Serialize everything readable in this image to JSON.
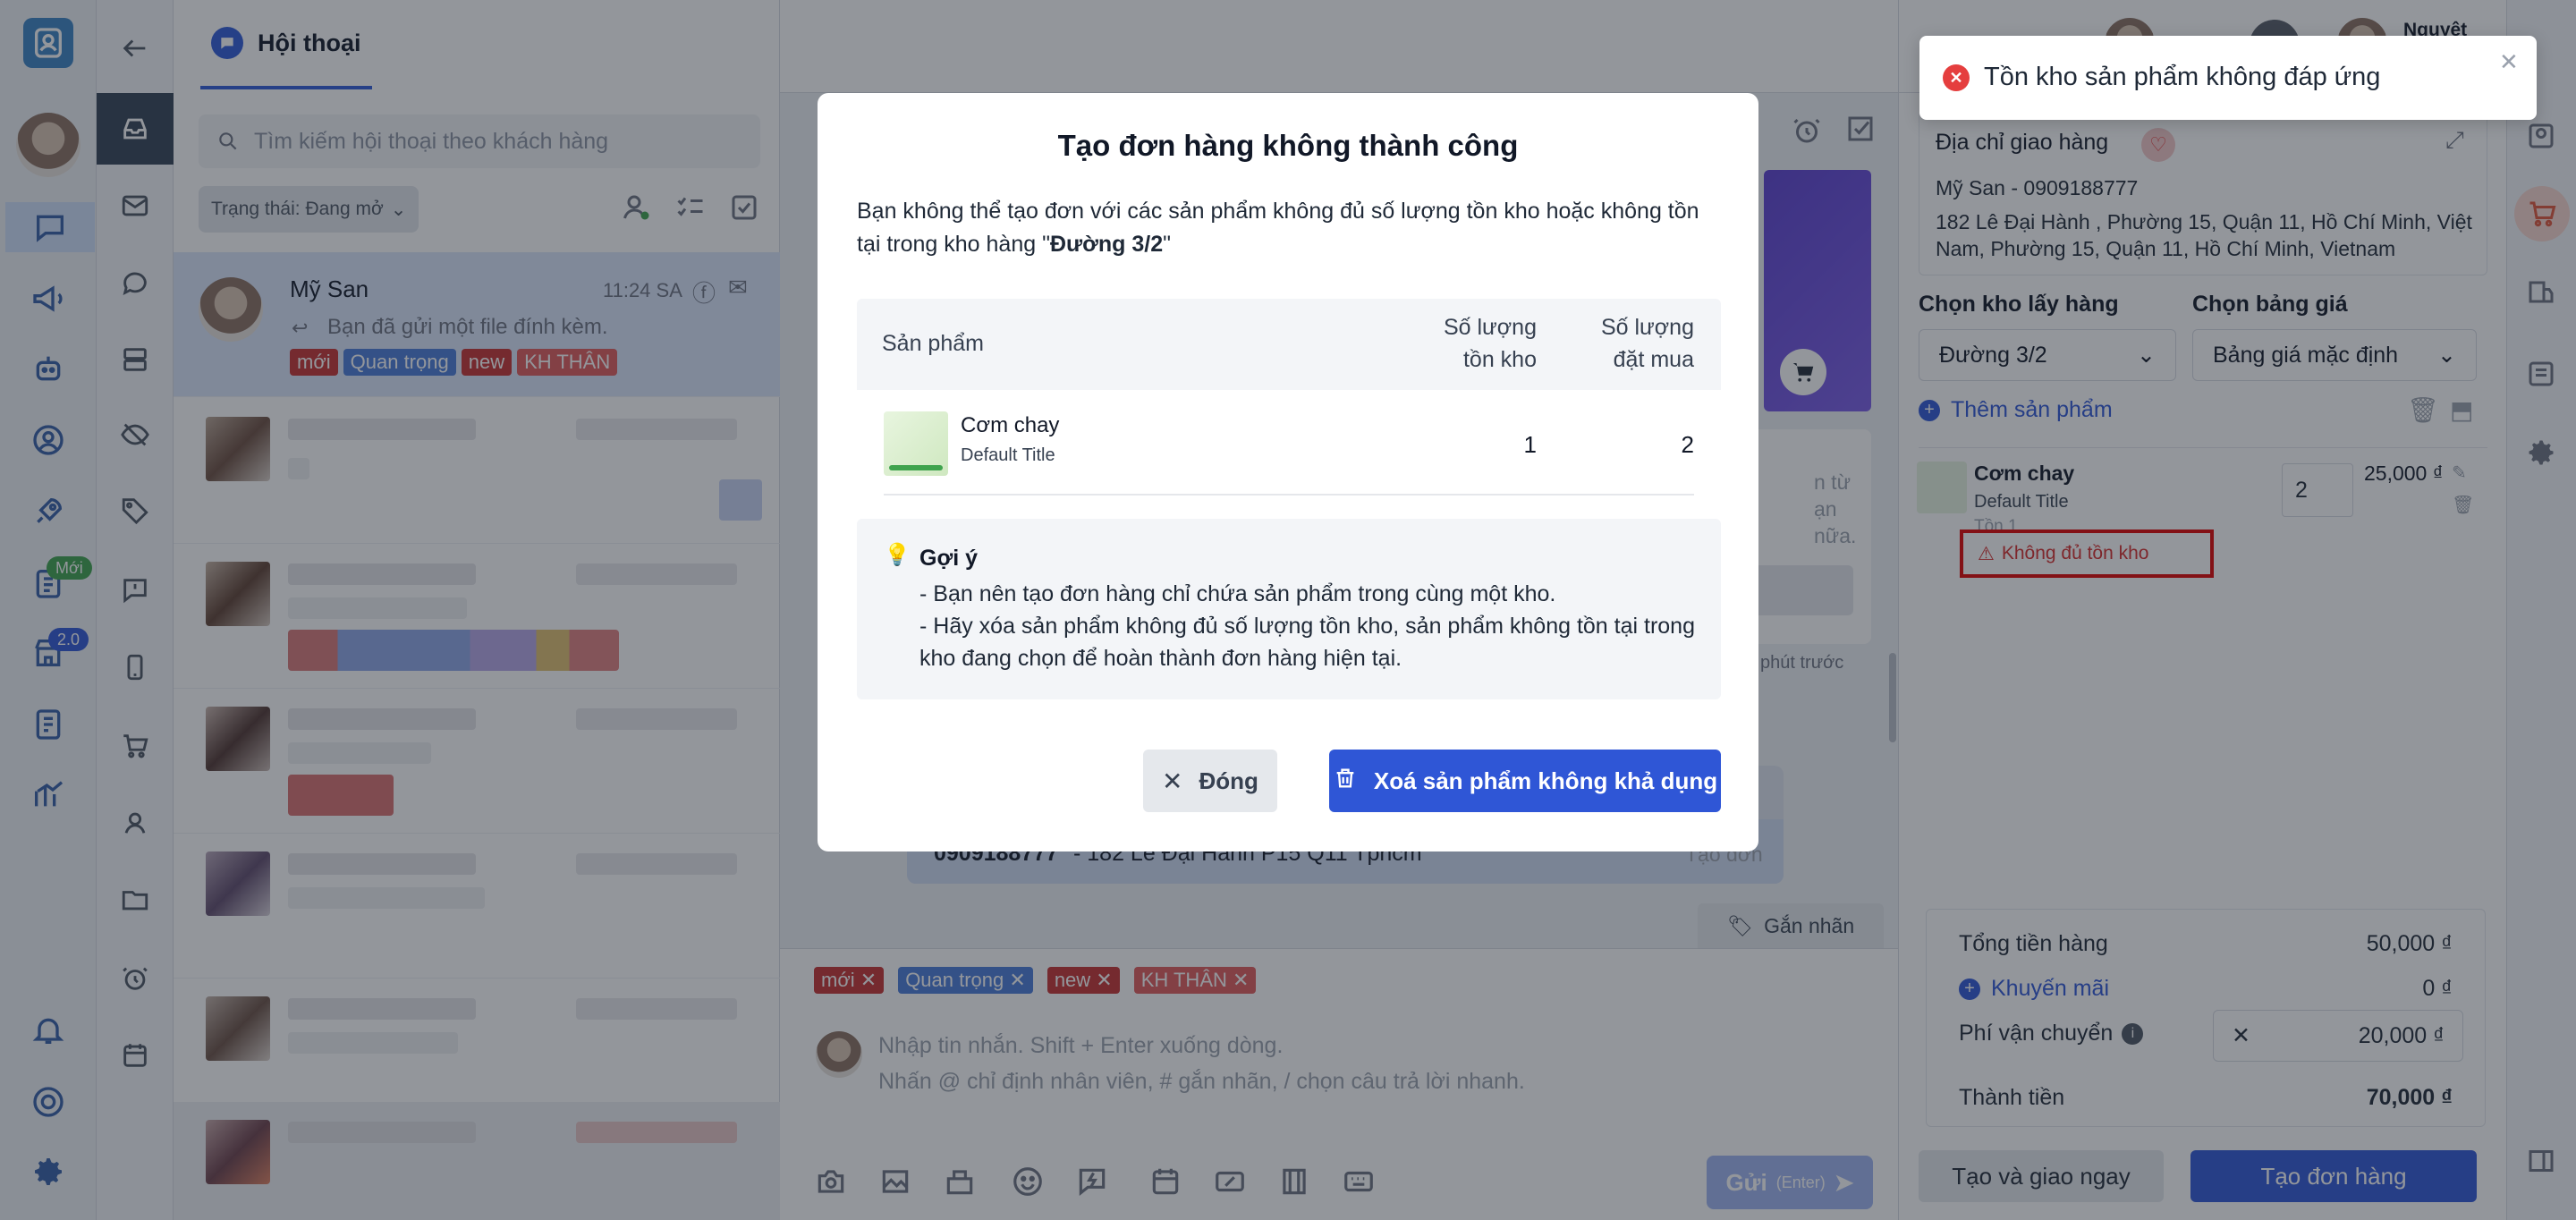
{
  "colors": {
    "primary": "#2f56d6",
    "danger": "#e53e3e",
    "tag_new": "#c53030",
    "tag_important": "#4a7bd8",
    "tag_kh": "#e05a5a"
  },
  "rail": {
    "items": [
      {
        "name": "app-logo-icon"
      },
      {
        "name": "chat-icon"
      },
      {
        "name": "megaphone-icon"
      },
      {
        "name": "bot-icon"
      },
      {
        "name": "user-circle-icon"
      },
      {
        "name": "rocket-icon"
      },
      {
        "name": "orders-icon",
        "badge": "Mới"
      },
      {
        "name": "shop-icon",
        "badge": "2.0"
      },
      {
        "name": "invoice-icon"
      },
      {
        "name": "analytics-icon"
      },
      {
        "name": "bell-settings-icon"
      },
      {
        "name": "support-icon"
      },
      {
        "name": "settings-icon"
      }
    ]
  },
  "list": {
    "tab_label": "Hội thoại",
    "search_placeholder": "Tìm kiếm hội thoại theo khách hàng",
    "filter_label": "Trạng thái: Đang mở",
    "selected": {
      "name": "Mỹ San",
      "time": "11:24 SA",
      "preview": "Bạn đã gửi một file đính kèm.",
      "tags": [
        "mới",
        "Quan trọng",
        "new",
        "KH THÂN"
      ]
    }
  },
  "chat": {
    "customer_line_phone": "0909188777",
    "customer_line_address": " - 182 Le Đại Hành P15 Q11 Tphcm",
    "create_order_hint": "Tạo đơn",
    "label_button": "Gắn nhãn",
    "tags": [
      "mới",
      "Quan trọng",
      "new",
      "KH THÂN"
    ],
    "composer_placeholder_1": "Nhập tin nhắn. Shift + Enter xuống dòng.",
    "composer_placeholder_2": "Nhấn @ chỉ định nhân viên, # gắn nhãn, / chọn câu trả lời nhanh.",
    "send_label": "Gửi",
    "send_hint": "(Enter)",
    "bg_snippet_1": "n từ",
    "bg_snippet_2": "ạn",
    "bg_snippet_3": "nữa.",
    "bg_time": "phút trước"
  },
  "right": {
    "header_user": "Nguyệt Shop",
    "address_title": "Địa chỉ giao hàng",
    "contact": "Mỹ San - 0909188777",
    "address": "182 Lê Đại Hành , Phường 15, Quận 11, Hồ Chí Minh, Việt Nam, Phường 15, Quận 11, Hồ Chí Minh, Vietnam",
    "warehouse_label": "Chọn kho lấy hàng",
    "warehouse_value": "Đường 3/2",
    "pricelist_label": "Chọn bảng giá",
    "pricelist_value": "Bảng giá mặc định",
    "add_product": "Thêm sản phẩm",
    "product": {
      "name": "Cơm chay",
      "variant": "Default Title",
      "stock_note": "Tồn 1",
      "qty": "2",
      "price": "25,000 ₫"
    },
    "stock_warning": "Không đủ tồn kho",
    "summary": {
      "subtotal_label": "Tổng tiền hàng",
      "subtotal": "50,000 ₫",
      "promo_label": "Khuyến mãi",
      "promo": "0 ₫",
      "shipping_label": "Phí vận chuyển",
      "shipping": "20,000 ₫",
      "total_label": "Thành tiền",
      "total": "70,000 ₫"
    },
    "btn_create_ship": "Tạo và giao ngay",
    "btn_create": "Tạo đơn hàng"
  },
  "modal": {
    "title": "Tạo đơn hàng không thành công",
    "desc_prefix": "Bạn không thể tạo đơn với các sản phẩm không đủ số lượng tồn kho hoặc không tồn tại trong kho hàng \"",
    "desc_warehouse": "Đường 3/2",
    "desc_suffix": "\"",
    "col_product": "Sản phẩm",
    "col_stock_1": "Số lượng",
    "col_stock_2": "tồn kho",
    "col_order_1": "Số lượng",
    "col_order_2": "đặt mua",
    "rows": [
      {
        "name": "Cơm chay",
        "variant": "Default Title",
        "stock": "1",
        "ordered": "2"
      }
    ],
    "hint_title": "Gợi ý",
    "hint_1": "- Bạn nên tạo đơn hàng chỉ chứa sản phẩm trong cùng một kho.",
    "hint_2": "- Hãy xóa sản phẩm không đủ số lượng tồn kho, sản phẩm không tồn tại trong kho đang chọn để hoàn thành đơn hàng hiện tại.",
    "btn_close": "Đóng",
    "btn_remove": "Xoá sản phẩm không khả dụng"
  },
  "toast": {
    "message": "Tồn kho sản phẩm không đáp ứng"
  }
}
